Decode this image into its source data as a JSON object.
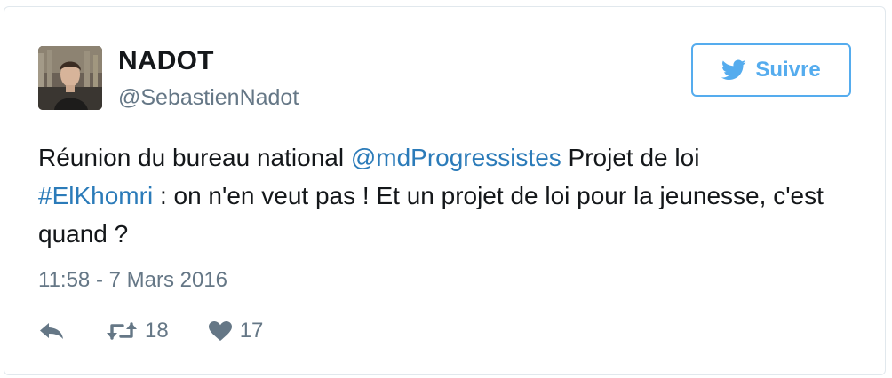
{
  "tweet": {
    "author": {
      "name": "NADOT",
      "handle": "@SebastienNadot",
      "avatar": "profile-photo"
    },
    "follow_button": {
      "label": "Suivre",
      "icon": "twitter-bird-icon"
    },
    "text": {
      "part1": "Réunion du bureau national ",
      "mention": "@mdProgressistes",
      "part2": " Projet de loi ",
      "hashtag": "#ElKhomri",
      "part3": " : on n'en veut pas ! Et un projet de loi pour la jeunesse, c'est quand ?"
    },
    "timestamp": "11:58 - 7 Mars 2016",
    "actions": {
      "reply": {
        "icon": "reply-icon"
      },
      "retweet": {
        "icon": "retweet-icon",
        "count": "18"
      },
      "like": {
        "icon": "heart-icon",
        "count": "17"
      }
    },
    "colors": {
      "accent": "#55acee",
      "link": "#2b7bb9",
      "secondary_text": "#657786",
      "primary_text": "#14171a",
      "border": "#e1e8ed"
    }
  }
}
